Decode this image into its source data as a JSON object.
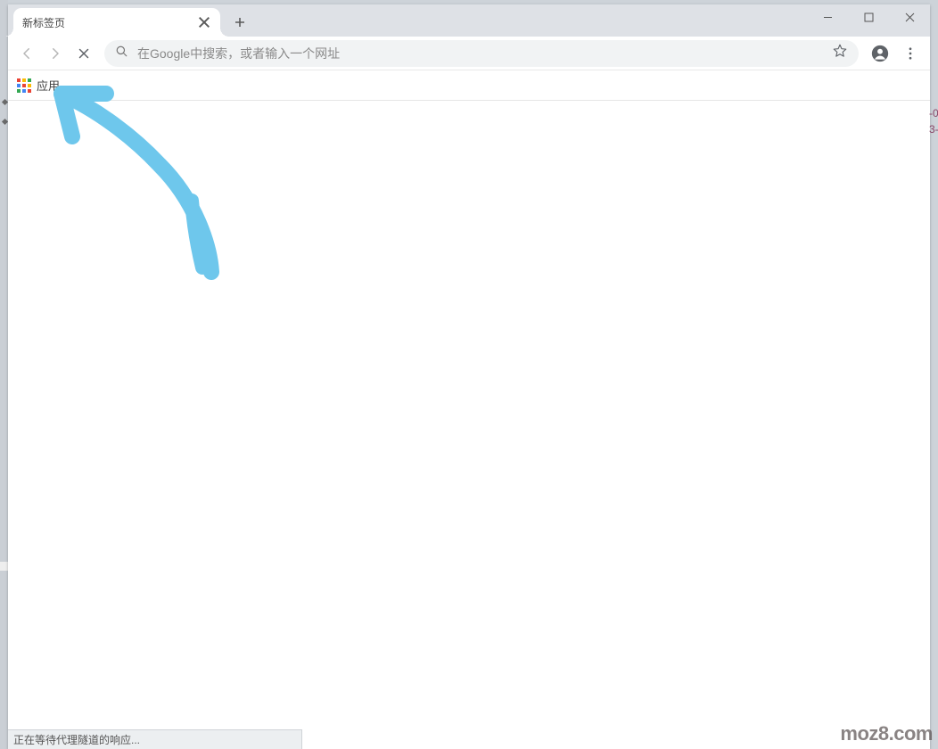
{
  "tab": {
    "title": "新标签页"
  },
  "omnibox": {
    "placeholder": "在Google中搜索，或者输入一个网址",
    "value": ""
  },
  "bookmarks": {
    "apps_label": "应用"
  },
  "status": {
    "text": "正在等待代理隧道的响应..."
  },
  "right_cutoff": {
    "line1": "-0",
    "line2": "3-"
  },
  "watermark": {
    "text": "moz8.com"
  },
  "apps_colors": [
    "#ea4335",
    "#fbbc05",
    "#34a853",
    "#4285f4",
    "#ea4335",
    "#fbbc05",
    "#34a853",
    "#4285f4",
    "#ea4335"
  ],
  "annotation": {
    "color": "#6ec7ec"
  }
}
